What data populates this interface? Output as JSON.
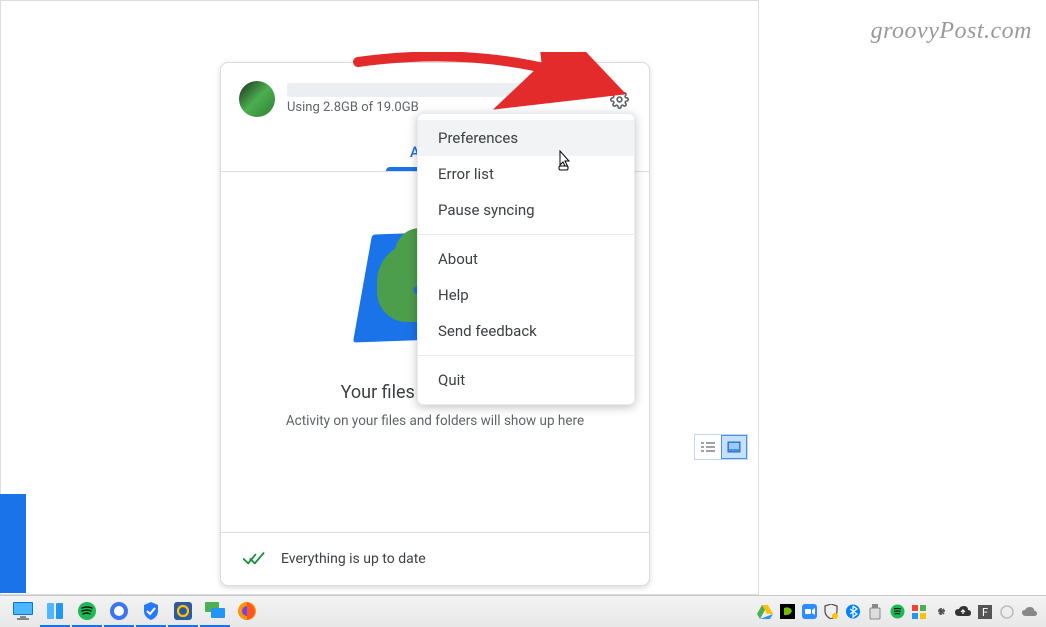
{
  "watermark": "groovyPost.com",
  "header": {
    "storage": "Using 2.8GB of 19.0GB"
  },
  "tabs": {
    "activity": "Activity"
  },
  "body": {
    "title": "Your files are up to date",
    "subtitle": "Activity on your files and folders will show up here"
  },
  "footer": {
    "status": "Everything is up to date"
  },
  "menu": {
    "preferences": "Preferences",
    "error_list": "Error list",
    "pause": "Pause syncing",
    "about": "About",
    "help": "Help",
    "feedback": "Send feedback",
    "quit": "Quit"
  }
}
